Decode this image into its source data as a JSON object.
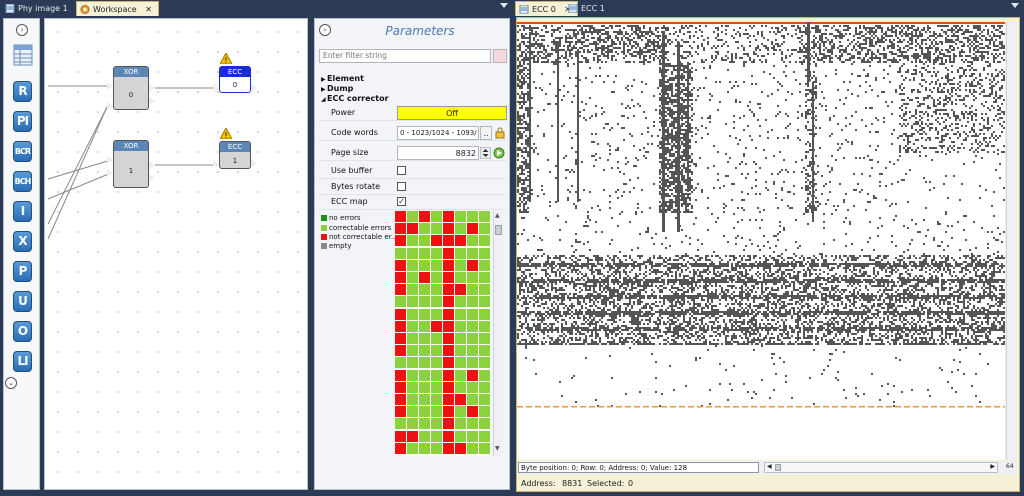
{
  "left_tabs": [
    {
      "label": "Phy image 1"
    },
    {
      "label": "Workspace"
    }
  ],
  "right_tabs": [
    {
      "label": "ECC 0"
    },
    {
      "label": "ECC 1"
    }
  ],
  "toolbox": {
    "buttons": [
      "R",
      "PI",
      "BCR",
      "BCH",
      "I",
      "X",
      "P",
      "U",
      "O",
      "LI"
    ]
  },
  "nodes": [
    {
      "title": "XOR",
      "value": "0"
    },
    {
      "title": "ECC",
      "value": "0"
    },
    {
      "title": "XOR",
      "value": "1"
    },
    {
      "title": "ECC",
      "value": "1"
    }
  ],
  "parameters": {
    "title": "Parameters",
    "filter_placeholder": "Enter filter string",
    "groups": [
      "Element",
      "Dump",
      "ECC corrector"
    ],
    "rows": {
      "power_label": "Power",
      "power_value": "Off",
      "codewords_label": "Code words",
      "codewords_value": "0 - 1023/1024 - 1093/",
      "codewords_btn": "..",
      "pagesize_label": "Page size",
      "pagesize_value": "8832",
      "usebuffer_label": "Use buffer",
      "bytesrotate_label": "Bytes rotate",
      "eccmap_label": "ECC map",
      "eccmap_checked": "✓"
    },
    "legend": [
      {
        "label": "no errors",
        "color": "#1a8f1a"
      },
      {
        "label": "correctable errors",
        "color": "#8cd23c"
      },
      {
        "label": "not correctable er...",
        "color": "#ee1111"
      },
      {
        "label": "empty",
        "color": "#888888"
      }
    ]
  },
  "ecc_view": {
    "position_text": "Byte position: 0; Row: 0; Address: 0; Value: 128",
    "zoom": "64",
    "address_label": "Address:",
    "address_value": "8831",
    "selected_label": "Selected:",
    "selected_value": "0"
  },
  "colors": {
    "accent": "#4a7bb7",
    "tool_blue": "#2a6db5",
    "power_off": "#ffff00",
    "selected_node": "#1b2bd6"
  }
}
